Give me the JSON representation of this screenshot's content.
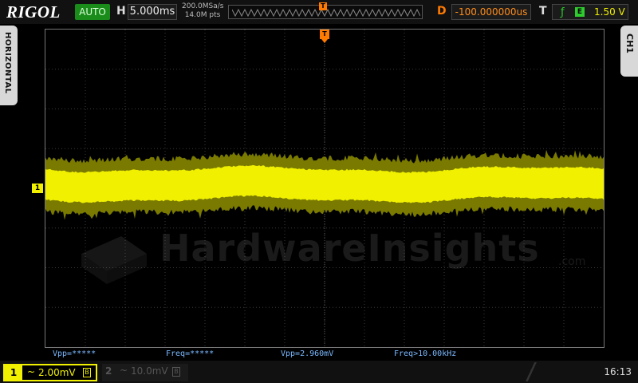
{
  "header": {
    "brand": "RIGOL",
    "mode": "AUTO",
    "horizontal_label": "H",
    "timebase": "5.000ms",
    "sample_rate": "200.0MSa/s",
    "memory_depth": "14.0M pts",
    "trigger_marker": "T",
    "delay_label": "D",
    "delay": "-100.000000us",
    "trigger_label": "T",
    "trigger_edge": "f",
    "trigger_source": "E",
    "trigger_level": "1.50 V"
  },
  "side_tabs": {
    "left": "HORIZONTAL",
    "right": "CH1"
  },
  "markers": {
    "trigger_position": "T",
    "ch1_ground": "1"
  },
  "watermark": {
    "text": "HardwareInsights",
    "suffix": ".com"
  },
  "measurements": [
    {
      "text": "Vpp=*****"
    },
    {
      "text": "Freq=*****"
    },
    {
      "text": "Vpp=2.960mV"
    },
    {
      "text": "Freq>10.00kHz"
    }
  ],
  "channels": {
    "ch1": {
      "number": "1",
      "coupling": "~",
      "scale": "2.00mV",
      "bw_limit": "B"
    },
    "ch2": {
      "number": "2",
      "coupling": "~",
      "scale": "10.0mV",
      "bw_limit": "B"
    }
  },
  "status": {
    "clock": "16:13"
  },
  "colors": {
    "ch1": "#f0f000",
    "trigger": "#ff7a00",
    "measurement": "#7ab8ff",
    "mode_green": "#1a8c1a"
  }
}
